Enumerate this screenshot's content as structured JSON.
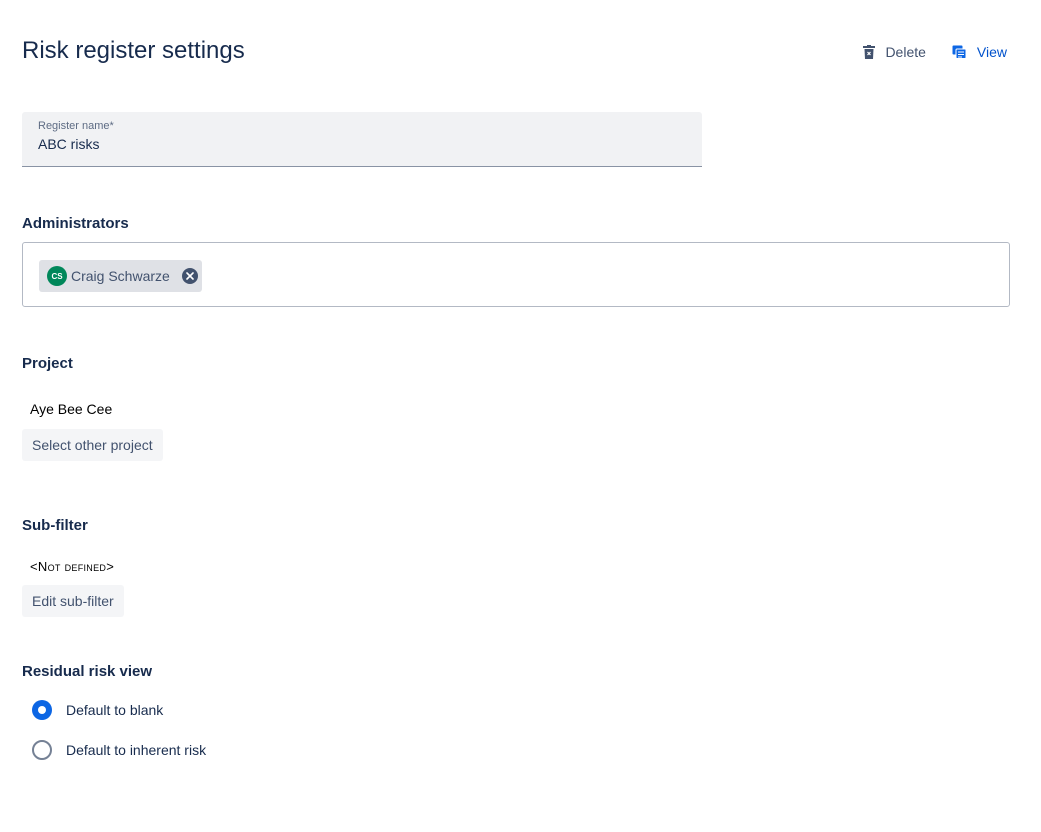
{
  "page": {
    "title": "Risk register settings"
  },
  "header_actions": {
    "delete_label": "Delete",
    "view_label": "View",
    "delete_icon": "trash-icon",
    "view_icon": "copy-icon"
  },
  "register_name": {
    "label": "Register name*",
    "value": "ABC risks"
  },
  "administrators": {
    "heading": "Administrators",
    "users": [
      {
        "initials": "CS",
        "name": "Craig Schwarze",
        "avatar_color": "#00875a"
      }
    ]
  },
  "project": {
    "heading": "Project",
    "value": "Aye Bee Cee",
    "button_label": "Select other project"
  },
  "sub_filter": {
    "heading": "Sub-filter",
    "value": "<Not defined>",
    "button_label": "Edit sub-filter"
  },
  "residual_risk_view": {
    "heading": "Residual risk view",
    "options": [
      {
        "label": "Default to blank",
        "selected": true
      },
      {
        "label": "Default to inherent risk",
        "selected": false
      }
    ]
  },
  "colors": {
    "accent": "#0c66e4",
    "link": "#0052cc",
    "text": "#172b4d"
  }
}
